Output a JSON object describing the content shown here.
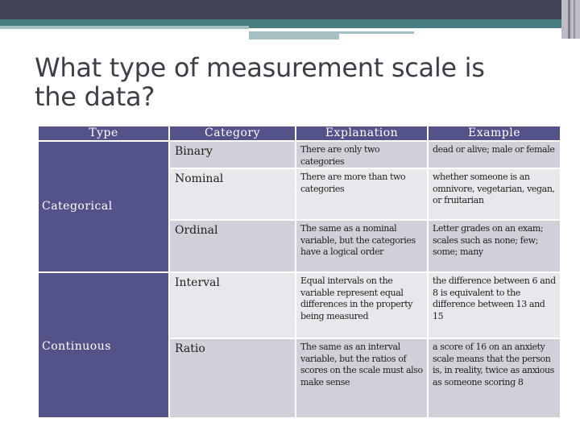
{
  "slide": {
    "title": "What type of measurement scale is the data?",
    "colors": {
      "header_band": "#434357",
      "accent_teal": "#467e82",
      "table_header": "#53538a",
      "row_dark": "#d0d0d8",
      "row_light": "#e7e7ec"
    }
  },
  "table": {
    "headers": [
      "Type",
      "Category",
      "Explanation",
      "Example"
    ],
    "types": [
      "Categorical",
      "Continuous"
    ],
    "rows": [
      {
        "category": "Binary",
        "explanation": "There are only two categories",
        "example": "dead or alive; male or female"
      },
      {
        "category": "Nominal",
        "explanation": "There are more than two categories",
        "example": "whether someone is an omnivore, vegetarian, vegan, or fruitarian"
      },
      {
        "category": "Ordinal",
        "explanation": "The same as a nominal variable, but the categories have a logical order",
        "example": "Letter grades on an exam; scales such as none; few; some; many"
      },
      {
        "category": "Interval",
        "explanation": "Equal intervals on the variable represent equal differences in the property being measured",
        "example": "the difference between 6 and 8 is equivalent to the difference between 13 and 15"
      },
      {
        "category": "Ratio",
        "explanation": "The same as an interval variable, but the ratios of scores on the scale must also make sense",
        "example": "a score of 16 on an anxiety scale means that the person is, in reality, twice as anxious as someone scoring 8"
      }
    ]
  }
}
